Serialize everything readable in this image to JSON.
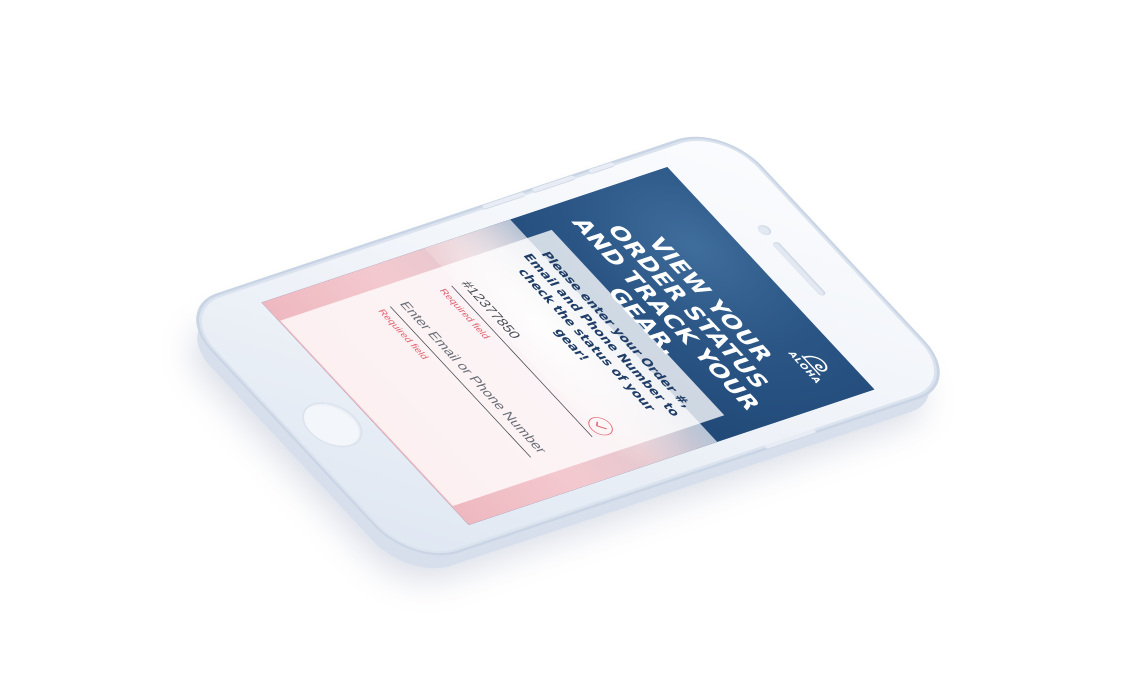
{
  "screen": {
    "logo": {
      "icon": "aloha-wave-icon",
      "text": "ALOHA"
    },
    "headline": "VIEW YOUR ORDER STATUS AND TRACK YOUR GEAR.",
    "intro": "Please enter your Order #, Email and Phone Number to check the status of your gear!",
    "order_field": {
      "value": "#12377850",
      "placeholder": "",
      "validation": "Required field",
      "status_icon": "check-circle-icon"
    },
    "contact_field": {
      "value": "",
      "placeholder": "Enter Email or Phone Number",
      "validation": "Required field"
    }
  },
  "colors": {
    "brand_blue": "#20497a",
    "text_navy": "#1f3d66",
    "error_red": "#e0626d",
    "card_white": "#ffffff"
  }
}
